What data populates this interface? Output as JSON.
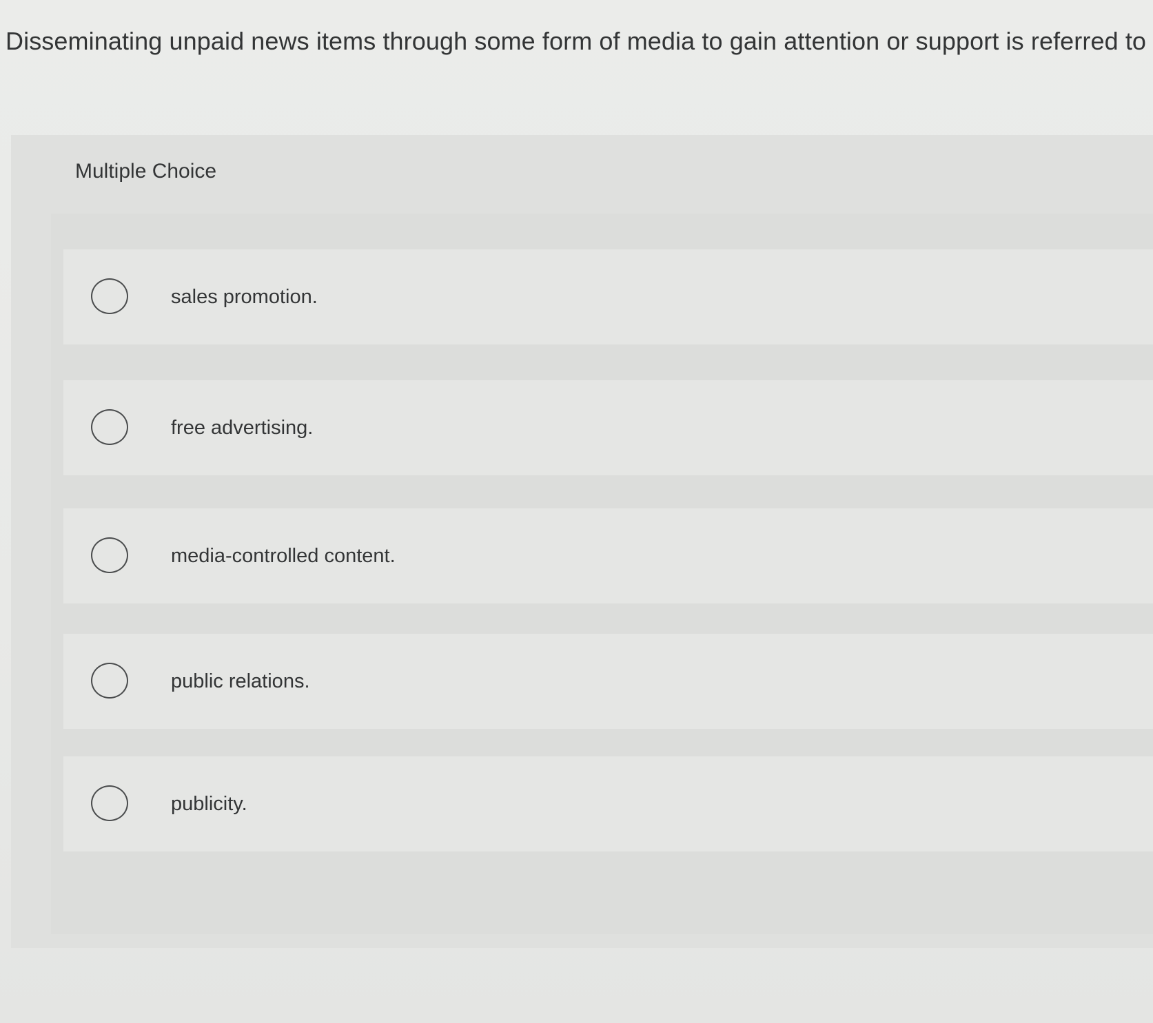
{
  "question": {
    "text": "Disseminating unpaid news items through some form of media to gain attention or support is referred to as"
  },
  "quiz": {
    "type_label": "Multiple Choice",
    "options": [
      {
        "label": "sales promotion.",
        "selected": false
      },
      {
        "label": "free advertising.",
        "selected": false
      },
      {
        "label": "media-controlled content.",
        "selected": false
      },
      {
        "label": "public relations.",
        "selected": false
      },
      {
        "label": "publicity.",
        "selected": false
      }
    ]
  },
  "colors": {
    "background": "#e9eae8",
    "panel": "#dfe0de",
    "option_row": "#e5e6e4",
    "text": "#333536",
    "radio_border": "#4a4c4d"
  }
}
